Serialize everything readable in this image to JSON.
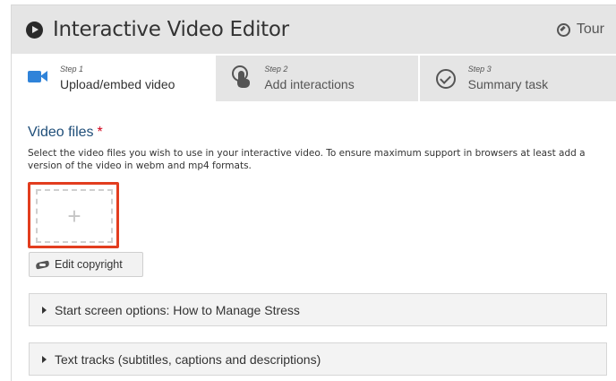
{
  "header": {
    "title": "Interactive Video Editor",
    "tour_label": "Tour",
    "logo_icon": "play-circle-icon",
    "tour_icon": "compass-icon"
  },
  "tabs": [
    {
      "step": "Step 1",
      "label": "Upload/embed video",
      "icon": "video-camera-icon",
      "active": true
    },
    {
      "step": "Step 2",
      "label": "Add interactions",
      "icon": "touch-icon",
      "active": false
    },
    {
      "step": "Step 3",
      "label": "Summary task",
      "icon": "check-circle-icon",
      "active": false
    }
  ],
  "video_files": {
    "title": "Video files",
    "required_marker": "*",
    "description": "Select the video files you wish to use in your interactive video. To ensure maximum support in browsers at least add a version of the video in webm and mp4 formats.",
    "add_symbol": "+",
    "edit_copyright_label": "Edit copyright",
    "copyright_icon": "handshake-icon"
  },
  "sections": [
    {
      "label": "Start screen options: How to Manage Stress"
    },
    {
      "label": "Text tracks (subtitles, captions and descriptions)"
    }
  ],
  "colors": {
    "accent_blue": "#2f83d9",
    "title_blue": "#1f4e79",
    "required_red": "#d0021b",
    "highlight_red": "#e23d1f",
    "header_gray": "#e5e5e5"
  }
}
